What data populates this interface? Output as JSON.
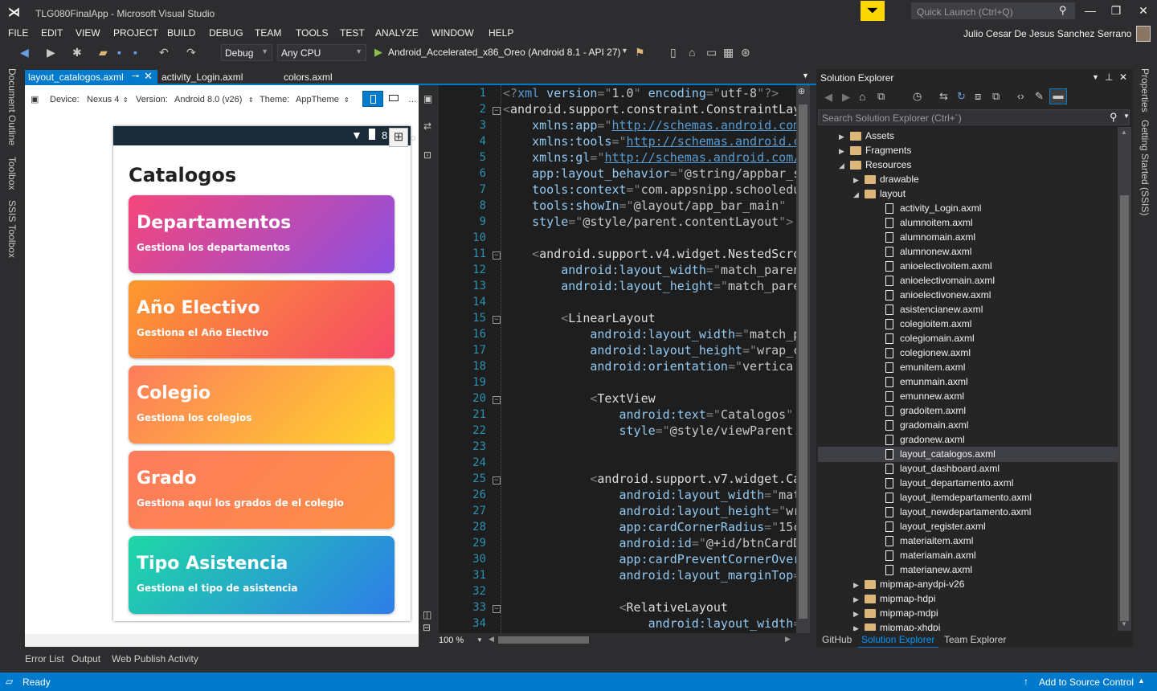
{
  "window": {
    "title": "TLG080FinalApp - Microsoft Visual Studio",
    "quick_launch_placeholder": "Quick Launch (Ctrl+Q)",
    "user": "Julio Cesar De Jesus Sanchez Serrano"
  },
  "menu": [
    "FILE",
    "EDIT",
    "VIEW",
    "PROJECT",
    "BUILD",
    "DEBUG",
    "TEAM",
    "TOOLS",
    "TEST",
    "ANALYZE",
    "WINDOW",
    "HELP"
  ],
  "toolbar": {
    "config": "Debug",
    "platform": "Any CPU",
    "target": "Android_Accelerated_x86_Oreo (Android 8.1 - API 27)"
  },
  "left_strip": [
    "Document Outline",
    "Toolbox",
    "SSIS Toolbox"
  ],
  "right_strip": [
    "Properties",
    "Getting Started (SSIS)"
  ],
  "tabs": [
    {
      "label": "layout_catalogos.axml",
      "active": true
    },
    {
      "label": "activity_Login.axml"
    },
    {
      "label": "colors.axml"
    }
  ],
  "designer": {
    "device_label": "Device:",
    "device": "Nexus 4",
    "version_label": "Version:",
    "version": "Android 8.0 (v26)",
    "theme_label": "Theme:",
    "theme": "AppTheme",
    "status_text": "8",
    "screen_title": "Catalogos",
    "cards": [
      {
        "title": "Departamentos",
        "subtitle": "Gestiona los departamentos",
        "from": "#f6467a",
        "to": "#8b4fe2"
      },
      {
        "title": "Año Electivo",
        "subtitle": "Gestiona el Año Electivo",
        "from": "#fd9a2d",
        "to": "#f64a68"
      },
      {
        "title": "Colegio",
        "subtitle": "Gestiona los colegios",
        "from": "#fd7c5a",
        "to": "#ffd52c"
      },
      {
        "title": "Grado",
        "subtitle": "Gestiona aquí los grados de el colegio",
        "from": "#fd7b5c",
        "to": "#fd8f45"
      },
      {
        "title": "Tipo Asistencia",
        "subtitle": "Gestiona el tipo de asistencia",
        "from": "#1fd8a6",
        "to": "#2d7de8"
      }
    ]
  },
  "code": {
    "line_numbers": [
      "1",
      "2",
      "3",
      "4",
      "5",
      "6",
      "7",
      "8",
      "9",
      "10",
      "11",
      "12",
      "13",
      "14",
      "15",
      "16",
      "17",
      "18",
      "19",
      "20",
      "21",
      "22",
      "23",
      "24",
      "25",
      "26",
      "27",
      "28",
      "29",
      "30",
      "31",
      "32",
      "33",
      "34"
    ],
    "lines": [
      [
        [
          "b",
          "<?"
        ],
        [
          "t",
          "xml"
        ],
        [
          "a",
          " version"
        ],
        [
          "b",
          "=\""
        ],
        [
          "v",
          "1.0"
        ],
        [
          "b",
          "\""
        ],
        [
          "a",
          " encoding"
        ],
        [
          "b",
          "=\""
        ],
        [
          "v",
          "utf-8"
        ],
        [
          "b",
          "\"?>"
        ]
      ],
      [
        [
          "b",
          "<"
        ],
        [
          "tx",
          "android.support.constraint.ConstraintLay"
        ]
      ],
      [
        [
          "a",
          "    xmlns:app"
        ],
        [
          "b",
          "=\""
        ],
        [
          "u",
          "http://schemas.android.com"
        ]
      ],
      [
        [
          "a",
          "    xmlns:tools"
        ],
        [
          "b",
          "=\""
        ],
        [
          "u",
          "http://schemas.android.c"
        ]
      ],
      [
        [
          "a",
          "    xmlns:gl"
        ],
        [
          "b",
          "=\""
        ],
        [
          "u",
          "http://schemas.android.com/"
        ]
      ],
      [
        [
          "a",
          "    app:layout_behavior"
        ],
        [
          "b",
          "=\""
        ],
        [
          "v",
          "@string/appbar_s"
        ]
      ],
      [
        [
          "a",
          "    tools:context"
        ],
        [
          "b",
          "=\""
        ],
        [
          "v",
          "com.appsnipp.schooledu"
        ]
      ],
      [
        [
          "a",
          "    tools:showIn"
        ],
        [
          "b",
          "=\""
        ],
        [
          "v",
          "@layout/app_bar_main"
        ],
        [
          "b",
          "\""
        ]
      ],
      [
        [
          "a",
          "    style"
        ],
        [
          "b",
          "=\""
        ],
        [
          "v",
          "@style/parent.contentLayout"
        ],
        [
          "b",
          "\">"
        ]
      ],
      [],
      [
        [
          "b",
          "    <"
        ],
        [
          "tx",
          "android.support.v4.widget.NestedScro"
        ]
      ],
      [
        [
          "a",
          "        android:layout_width"
        ],
        [
          "b",
          "=\""
        ],
        [
          "v",
          "match_paren"
        ]
      ],
      [
        [
          "a",
          "        android:layout_height"
        ],
        [
          "b",
          "=\""
        ],
        [
          "v",
          "match_pare"
        ]
      ],
      [],
      [
        [
          "b",
          "        <"
        ],
        [
          "tx",
          "LinearLayout"
        ]
      ],
      [
        [
          "a",
          "            android:layout_width"
        ],
        [
          "b",
          "=\""
        ],
        [
          "v",
          "match_p"
        ]
      ],
      [
        [
          "a",
          "            android:layout_height"
        ],
        [
          "b",
          "=\""
        ],
        [
          "v",
          "wrap_c"
        ]
      ],
      [
        [
          "a",
          "            android:orientation"
        ],
        [
          "b",
          "=\""
        ],
        [
          "v",
          "vertica"
        ]
      ],
      [],
      [
        [
          "b",
          "            <"
        ],
        [
          "tx",
          "TextView"
        ]
      ],
      [
        [
          "a",
          "                android:text"
        ],
        [
          "b",
          "=\""
        ],
        [
          "v",
          "Catalogos"
        ],
        [
          "b",
          "\""
        ]
      ],
      [
        [
          "a",
          "                style"
        ],
        [
          "b",
          "=\""
        ],
        [
          "v",
          "@style/viewParent."
        ]
      ],
      [],
      [],
      [
        [
          "b",
          "            <"
        ],
        [
          "tx",
          "android.support.v7.widget.Ca"
        ]
      ],
      [
        [
          "a",
          "                android:layout_width"
        ],
        [
          "b",
          "=\""
        ],
        [
          "v",
          "mat"
        ]
      ],
      [
        [
          "a",
          "                android:layout_height"
        ],
        [
          "b",
          "=\""
        ],
        [
          "v",
          "wr"
        ]
      ],
      [
        [
          "a",
          "                app:cardCornerRadius"
        ],
        [
          "b",
          "=\""
        ],
        [
          "v",
          "15c"
        ]
      ],
      [
        [
          "a",
          "                android:id"
        ],
        [
          "b",
          "=\""
        ],
        [
          "v",
          "@+id/btnCardD"
        ]
      ],
      [
        [
          "a",
          "                app:cardPreventCornerOver"
        ]
      ],
      [
        [
          "a",
          "                android:layout_marginTop"
        ],
        [
          "b",
          "="
        ]
      ],
      [],
      [
        [
          "b",
          "                <"
        ],
        [
          "tx",
          "RelativeLayout"
        ]
      ],
      [
        [
          "a",
          "                    android:layout_width"
        ],
        [
          "b",
          "="
        ]
      ]
    ],
    "zoom": "100 %"
  },
  "solution_explorer": {
    "title": "Solution Explorer",
    "search_placeholder": "Search Solution Explorer (Ctrl+´)",
    "tree": [
      {
        "label": "Assets",
        "type": "folder",
        "level": 0,
        "arrow": "▶"
      },
      {
        "label": "Fragments",
        "type": "folder",
        "level": 0,
        "arrow": "▶"
      },
      {
        "label": "Resources",
        "type": "folder",
        "level": 0,
        "arrow": "◢"
      },
      {
        "label": "drawable",
        "type": "folder",
        "level": 1,
        "arrow": "▶"
      },
      {
        "label": "layout",
        "type": "folder",
        "level": 1,
        "arrow": "◢"
      },
      {
        "label": "activity_Login.axml",
        "type": "file",
        "level": 2
      },
      {
        "label": "alumnoitem.axml",
        "type": "file",
        "level": 2
      },
      {
        "label": "alumnomain.axml",
        "type": "file",
        "level": 2
      },
      {
        "label": "alumnonew.axml",
        "type": "file",
        "level": 2
      },
      {
        "label": "anioelectivoitem.axml",
        "type": "file",
        "level": 2
      },
      {
        "label": "anioelectivomain.axml",
        "type": "file",
        "level": 2
      },
      {
        "label": "anioelectivonew.axml",
        "type": "file",
        "level": 2
      },
      {
        "label": "asistencianew.axml",
        "type": "file",
        "level": 2
      },
      {
        "label": "colegioitem.axml",
        "type": "file",
        "level": 2
      },
      {
        "label": "colegiomain.axml",
        "type": "file",
        "level": 2
      },
      {
        "label": "colegionew.axml",
        "type": "file",
        "level": 2
      },
      {
        "label": "emunitem.axml",
        "type": "file",
        "level": 2
      },
      {
        "label": "emunmain.axml",
        "type": "file",
        "level": 2
      },
      {
        "label": "emunnew.axml",
        "type": "file",
        "level": 2
      },
      {
        "label": "gradoitem.axml",
        "type": "file",
        "level": 2
      },
      {
        "label": "gradomain.axml",
        "type": "file",
        "level": 2
      },
      {
        "label": "gradonew.axml",
        "type": "file",
        "level": 2
      },
      {
        "label": "layout_catalogos.axml",
        "type": "file",
        "level": 2,
        "selected": true
      },
      {
        "label": "layout_dashboard.axml",
        "type": "file",
        "level": 2
      },
      {
        "label": "layout_departamento.axml",
        "type": "file",
        "level": 2
      },
      {
        "label": "layout_itemdepartamento.axml",
        "type": "file",
        "level": 2
      },
      {
        "label": "layout_newdepartamento.axml",
        "type": "file",
        "level": 2
      },
      {
        "label": "layout_register.axml",
        "type": "file",
        "level": 2
      },
      {
        "label": "materiaitem.axml",
        "type": "file",
        "level": 2
      },
      {
        "label": "materiamain.axml",
        "type": "file",
        "level": 2
      },
      {
        "label": "materianew.axml",
        "type": "file",
        "level": 2
      },
      {
        "label": "mipmap-anydpi-v26",
        "type": "folder",
        "level": 1,
        "arrow": "▶"
      },
      {
        "label": "mipmap-hdpi",
        "type": "folder",
        "level": 1,
        "arrow": "▶"
      },
      {
        "label": "mipmap-mdpi",
        "type": "folder",
        "level": 1,
        "arrow": "▶"
      },
      {
        "label": "mipmap-xhdpi",
        "type": "folder",
        "level": 1,
        "arrow": "▶"
      }
    ],
    "bottom_tabs": [
      {
        "label": "GitHub"
      },
      {
        "label": "Solution Explorer",
        "active": true
      },
      {
        "label": "Team Explorer"
      }
    ]
  },
  "bottom_tabs": [
    "Error List",
    "Output",
    "Web Publish Activity"
  ],
  "status": {
    "text": "Ready",
    "source_control": "Add to Source Control"
  },
  "colors": {
    "accent": "#007acc",
    "background": "#2d2d30",
    "editor": "#1e1e1e"
  }
}
